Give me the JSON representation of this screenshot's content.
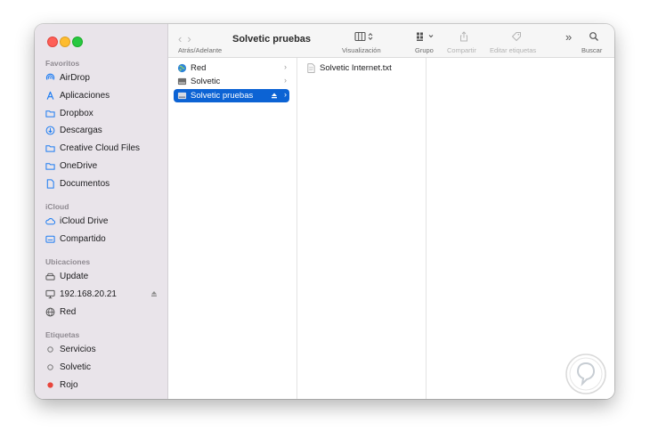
{
  "sidebar": {
    "sections": [
      {
        "title": "Favoritos",
        "items": [
          {
            "label": "AirDrop",
            "icon": "airdrop-icon"
          },
          {
            "label": "Aplicaciones",
            "icon": "applications-icon"
          },
          {
            "label": "Dropbox",
            "icon": "folder-icon"
          },
          {
            "label": "Descargas",
            "icon": "download-icon"
          },
          {
            "label": "Creative Cloud Files",
            "icon": "folder-icon"
          },
          {
            "label": "OneDrive",
            "icon": "folder-icon"
          },
          {
            "label": "Documentos",
            "icon": "document-icon"
          }
        ]
      },
      {
        "title": "iCloud",
        "items": [
          {
            "label": "iCloud Drive",
            "icon": "cloud-icon"
          },
          {
            "label": "Compartido",
            "icon": "shared-folder-icon"
          }
        ]
      },
      {
        "title": "Ubicaciones",
        "items": [
          {
            "label": "Update",
            "icon": "drive-icon"
          },
          {
            "label": "192.168.20.21",
            "icon": "computer-icon"
          },
          {
            "label": "Red",
            "icon": "globe-icon"
          }
        ]
      },
      {
        "title": "Etiquetas",
        "items": [
          {
            "label": "Servicios",
            "icon": "tag-empty-icon"
          },
          {
            "label": "Solvetic",
            "icon": "tag-empty-icon"
          },
          {
            "label": "Rojo",
            "icon": "tag-red-icon",
            "color": "#e8453c"
          }
        ]
      }
    ]
  },
  "toolbar": {
    "nav_caption": "Atrás/Adelante",
    "title": "Solvetic pruebas",
    "view_caption": "Visualización",
    "group_caption": "Grupo",
    "share_caption": "Compartir",
    "tags_caption": "Editar etiquetas",
    "search_caption": "Buscar"
  },
  "columns": {
    "col1": [
      {
        "label": "Red",
        "icon": "globe-icon"
      },
      {
        "label": "Solvetic",
        "icon": "drive-icon"
      },
      {
        "label": "Solvetic pruebas",
        "icon": "drive-icon",
        "selected": true
      }
    ],
    "col2": [
      {
        "label": "Solvetic Internet.txt",
        "icon": "text-file-icon"
      }
    ]
  },
  "colors": {
    "accent": "#0c63d4",
    "sidebar_bg": "#e9e4ea"
  }
}
